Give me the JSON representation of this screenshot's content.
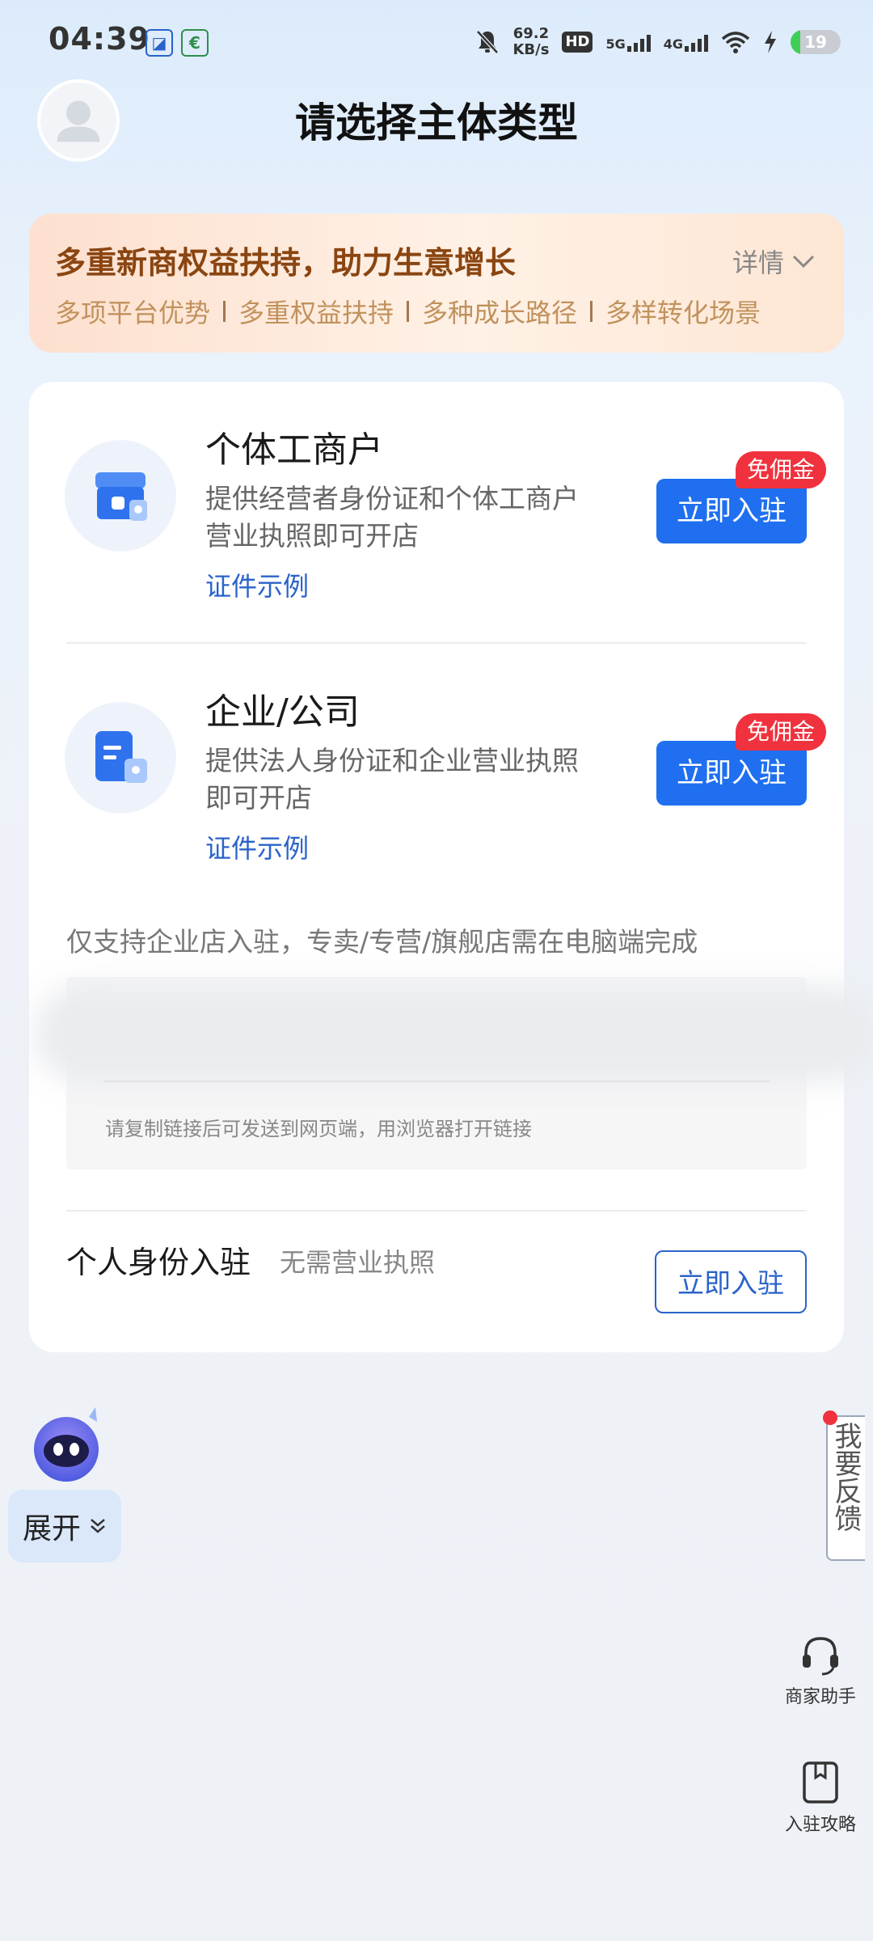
{
  "status_bar": {
    "time": "04:39",
    "net_speed_value": "69.2",
    "net_speed_unit": "KB/s",
    "hd_label": "HD",
    "sim1_label": "5G",
    "sim2_label": "4G",
    "battery_percent": "19",
    "battery_level": 0.19,
    "icons": [
      "app-notification-icon",
      "post-office-icon",
      "mute-bell-icon",
      "signal-icon",
      "wifi-icon",
      "charging-icon",
      "battery-icon"
    ]
  },
  "header": {
    "title": "请选择主体类型"
  },
  "promo": {
    "title": "多重新商权益扶持，助力生意增长",
    "detail_label": "详情",
    "tags": [
      "多项平台优势",
      "多重权益扶持",
      "多种成长路径",
      "多样转化场景"
    ]
  },
  "options": [
    {
      "title": "个体工商户",
      "desc_line1": "提供经营者身份证和个体工商户",
      "desc_line2": "营业执照即可开店",
      "link": "证件示例",
      "button": "立即入驻",
      "badge": "免佣金",
      "icon": "storefront-icon"
    },
    {
      "title": "企业/公司",
      "desc_line1": "提供法人身份证和企业营业执照",
      "desc_line2": "即可开店",
      "link": "证件示例",
      "button": "立即入驻",
      "badge": "免佣金",
      "icon": "document-icon"
    }
  ],
  "notice": "仅支持企业店入驻，专卖/专营/旗舰店需在电脑端完成",
  "link_box": {
    "hint": "请复制链接后可发送到网页端，用浏览器打开链接"
  },
  "personal": {
    "title": "个人身份入驻",
    "subtitle": "无需营业执照",
    "button": "立即入驻"
  },
  "assistant": {
    "expand_label": "展开"
  },
  "feedback": {
    "label": "我要反馈"
  },
  "side_tools": [
    {
      "label": "商家助手",
      "icon": "headset-icon"
    },
    {
      "label": "入驻攻略",
      "icon": "guide-book-icon"
    }
  ],
  "colors": {
    "primary": "#1f6ff0",
    "link": "#2a63c9",
    "badge": "#f0323e",
    "promo_title": "#8a4511",
    "promo_tag": "#c1925c"
  }
}
